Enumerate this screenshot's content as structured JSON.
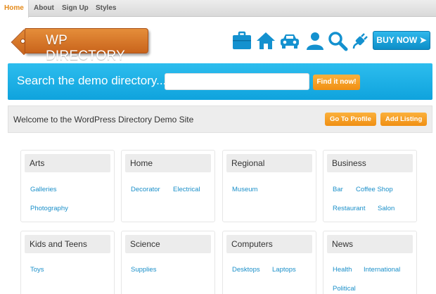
{
  "nav": {
    "items": [
      {
        "label": "Home",
        "active": true
      },
      {
        "label": "About"
      },
      {
        "label": "Sign Up"
      },
      {
        "label": "Styles"
      }
    ]
  },
  "logo": {
    "text": "WP DIRECTORY"
  },
  "header": {
    "icons": [
      "briefcase-icon",
      "house-icon",
      "car-icon",
      "person-icon",
      "magnifier-icon",
      "plug-icon"
    ],
    "buy_label": "BUY NOW ➤"
  },
  "search": {
    "label": "Search the demo directory...",
    "value": "",
    "button_label": "Find it now!"
  },
  "welcome": {
    "text": "Welcome to the WordPress Directory Demo Site",
    "profile_label": "Go To Profile",
    "add_label": "Add Listing"
  },
  "categories": [
    {
      "title": "Arts",
      "links": [
        "Galleries",
        "Photography"
      ]
    },
    {
      "title": "Home",
      "links": [
        "Decorator",
        "Electrical"
      ]
    },
    {
      "title": "Regional",
      "links": [
        "Museum"
      ]
    },
    {
      "title": "Business",
      "links": [
        "Bar",
        "Coffee Shop",
        "Restaurant",
        "Salon"
      ]
    },
    {
      "title": "Kids and Teens",
      "links": [
        "Toys"
      ]
    },
    {
      "title": "Science",
      "links": [
        "Supplies"
      ]
    },
    {
      "title": "Computers",
      "links": [
        "Desktops",
        "Laptops"
      ]
    },
    {
      "title": "News",
      "links": [
        "Health",
        "International",
        "Political"
      ]
    }
  ],
  "colors": {
    "accent_blue": "#15a8e2",
    "accent_orange": "#f39a1f",
    "logo_orange": "#d9772a",
    "link_blue": "#1a8fc9",
    "nav_active": "#e48a1a"
  }
}
